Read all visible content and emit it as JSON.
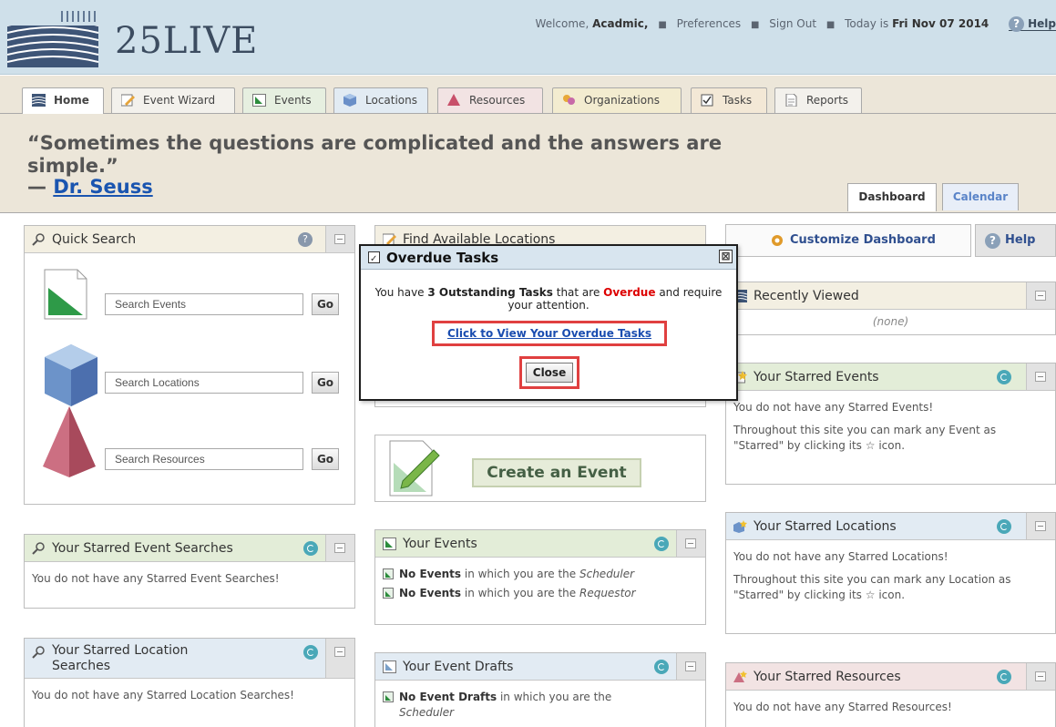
{
  "header": {
    "logo_text": "25LIVE",
    "welcome_prefix": "Welcome,",
    "user": "Acadmic,",
    "preferences": "Preferences",
    "sign_out": "Sign Out",
    "today_prefix": "Today is",
    "today_date": "Fri Nov 07 2014",
    "help": "Help"
  },
  "nav": {
    "tabs": [
      "Home",
      "Event Wizard",
      "Events",
      "Locations",
      "Resources",
      "Organizations",
      "Tasks",
      "Reports"
    ],
    "active_tab": "Home"
  },
  "quote": {
    "text": "“Sometimes the questions are complicated and the answers are simple.”",
    "dash": "—",
    "author": "Dr. Seuss"
  },
  "view_tabs": {
    "dashboard": "Dashboard",
    "calendar": "Calendar",
    "active": "Dashboard"
  },
  "quick_search": {
    "title": "Quick Search",
    "events_placeholder": "Search Events",
    "locations_placeholder": "Search Locations",
    "resources_placeholder": "Search Resources",
    "go": "Go"
  },
  "find_locations": {
    "title": "Find Available Locations"
  },
  "create_event": {
    "label": "Create an Event"
  },
  "dashboard_controls": {
    "customize": "Customize Dashboard",
    "help": "Help"
  },
  "recently_viewed": {
    "title": "Recently Viewed",
    "empty": "(none)"
  },
  "starred_events": {
    "title": "Your Starred Events",
    "empty": "You do not have any Starred Events!",
    "hint": "Throughout this site you can mark any Event as \"Starred\" by clicking its ☆ icon."
  },
  "starred_locations": {
    "title": "Your Starred Locations",
    "empty": "You do not have any Starred Locations!",
    "hint": "Throughout this site you can mark any Location as \"Starred\" by clicking its ☆ icon."
  },
  "starred_resources": {
    "title": "Your Starred Resources",
    "empty": "You do not have any Starred Resources!"
  },
  "starred_event_searches": {
    "title": "Your Starred Event Searches",
    "empty": "You do not have any Starred Event Searches!"
  },
  "starred_location_searches": {
    "title_line1": "Your Starred Location",
    "title_line2": "Searches",
    "empty": "You do not have any Starred Location Searches!"
  },
  "your_events": {
    "title": "Your Events",
    "line1_bold": "No Events",
    "line1_rest": " in which you are the ",
    "line1_role": "Scheduler",
    "line2_bold": "No Events",
    "line2_rest": " in which you are the ",
    "line2_role": "Requestor"
  },
  "event_drafts": {
    "title": "Your Event Drafts",
    "line1_bold": "No Event Drafts",
    "line1_rest": " in which you are the",
    "line1_role": "Scheduler"
  },
  "dialog": {
    "title": "Overdue Tasks",
    "close_x": "⊠",
    "msg_pre": "You have ",
    "msg_count": "3 Outstanding Tasks",
    "msg_mid": " that are ",
    "msg_overdue": "Overdue",
    "msg_post": " and require your attention.",
    "link": "Click to View Your Overdue Tasks",
    "close_button": "Close"
  },
  "colors": {
    "header_bg": "#cfe0ea",
    "quote_area_bg": "#ece6d9",
    "link_blue": "#1a55b0",
    "overdue_red": "#dd0000",
    "highlight_red": "#e04040"
  }
}
